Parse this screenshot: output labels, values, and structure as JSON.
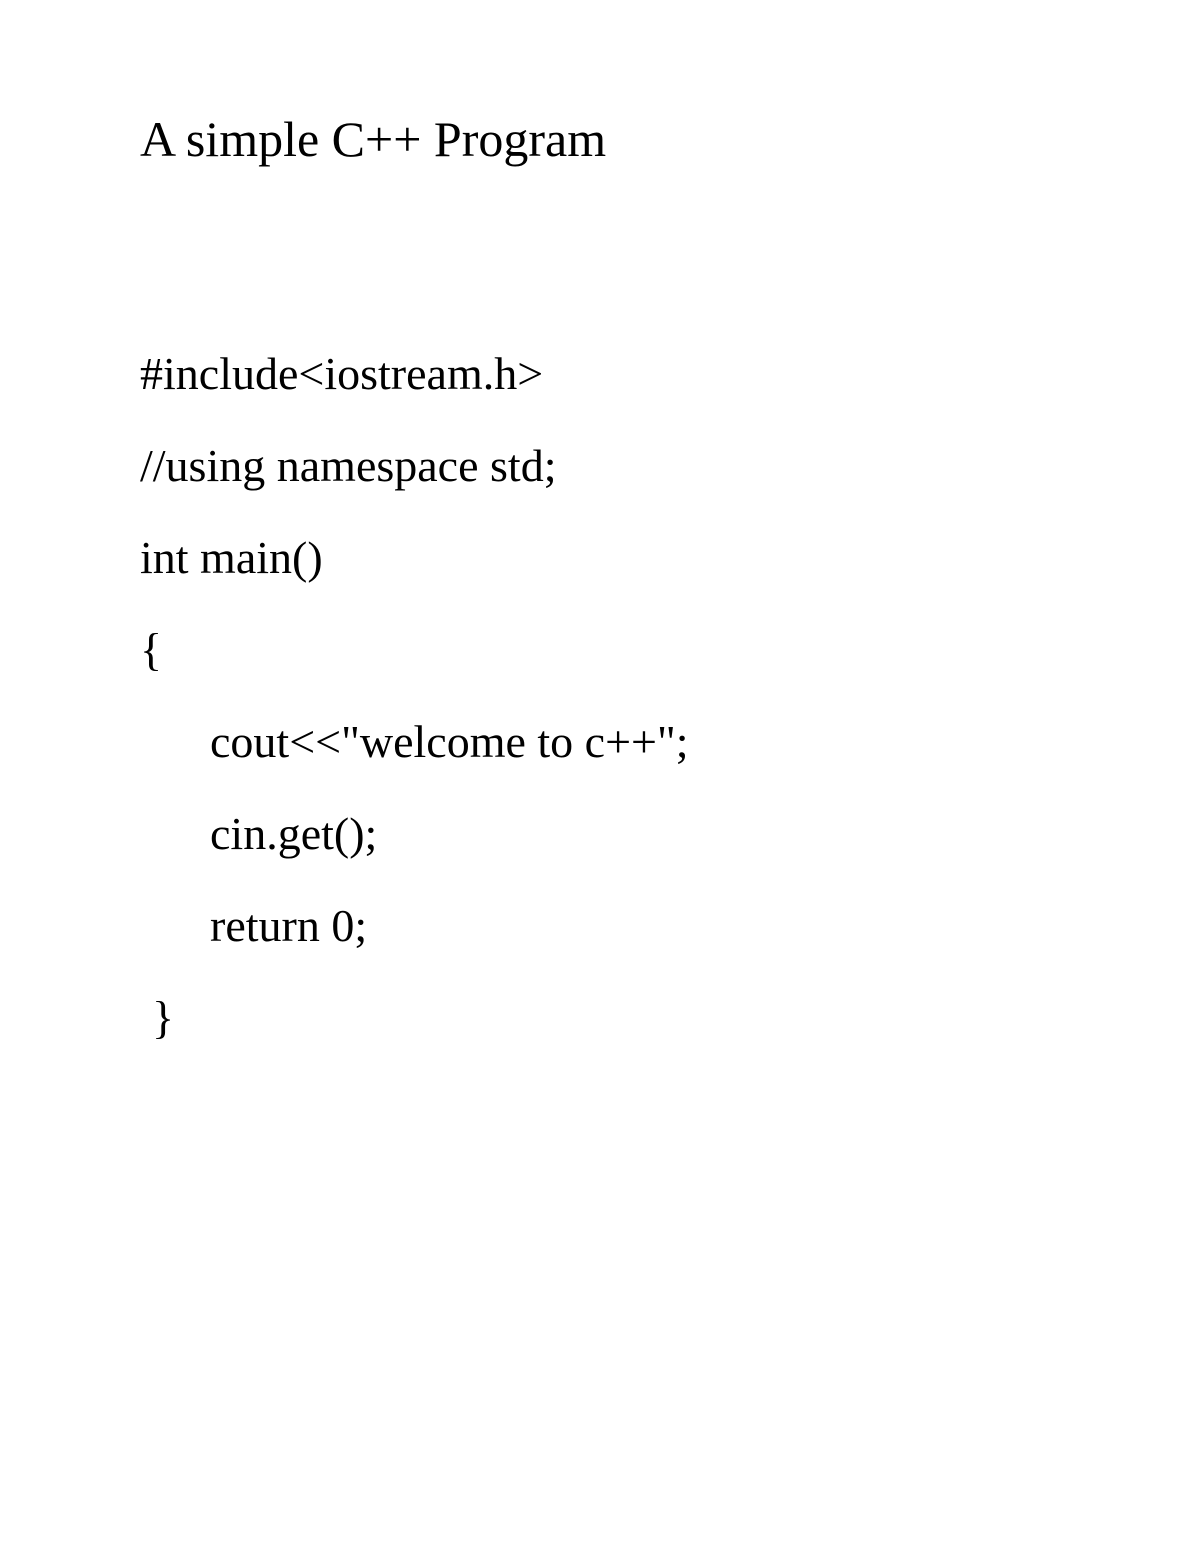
{
  "title": "A simple C++ Program",
  "code": {
    "line1": "#include<iostream.h>",
    "line2": "//using namespace std;",
    "line3": "int main()",
    "line4": "{",
    "line5": "cout<<\"welcome to c++\";",
    "line6": "cin.get();",
    "line7": "return 0;",
    "line8": "}"
  }
}
